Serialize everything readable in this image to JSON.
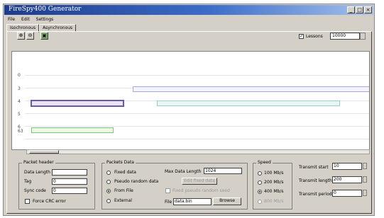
{
  "window": {
    "title": "FireSpy400 Generator",
    "controls": [
      "_",
      "□",
      "×"
    ]
  },
  "menu": [
    "File",
    "Edit",
    "Settings"
  ],
  "tabs": [
    "Isochronous",
    "Asynchronous"
  ],
  "toolbar": {
    "zoom_in_icon": "zoom-in-icon",
    "zoom_out_icon": "zoom-out-icon",
    "image_icon": "image-icon",
    "lessons_checked": true,
    "lessons_label": "Lessons",
    "lessons_value": "10000"
  },
  "timeline": {
    "row_labels": [
      "0",
      "3",
      "4",
      "5",
      "6",
      "63"
    ],
    "segment_colors": {
      "row3": "#a8acd8",
      "row4_selected": "#6a58a8",
      "row4_teal": "#9ccccc",
      "row63_green": "#7cc86a"
    }
  },
  "packet_header": {
    "title": "Packet header",
    "data_length_label": "Data Length",
    "data_length_value": "",
    "tag_label": "Tag",
    "tag_value": "0",
    "sync_code_label": "Sync code",
    "sync_code_value": "0",
    "force_crc_label": "Force CRC error"
  },
  "packets_data": {
    "title": "Packets Data",
    "options": [
      "Fixed data",
      "Pseudo random data",
      "From File",
      "External"
    ],
    "selected_index": 2,
    "max_data_length_label": "Max Data Length",
    "max_data_length_value": "1024",
    "edit_button": "Edit fixed data",
    "fixed_pseudo_label": "Fixed pseudo random seed",
    "file_label": "File",
    "file_value": "data.bin",
    "browse_button": "Browse"
  },
  "speed": {
    "title": "Speed",
    "options": [
      "100 Mb/s",
      "200 Mb/s",
      "400 Mb/s",
      "800 Mb/s"
    ],
    "selected_index": 2
  },
  "transmit": {
    "start_label": "Transmit start",
    "start_value": "10",
    "length_label": "Transmit length",
    "length_value": "200",
    "period_label": "Transmit period",
    "period_value": "0"
  }
}
